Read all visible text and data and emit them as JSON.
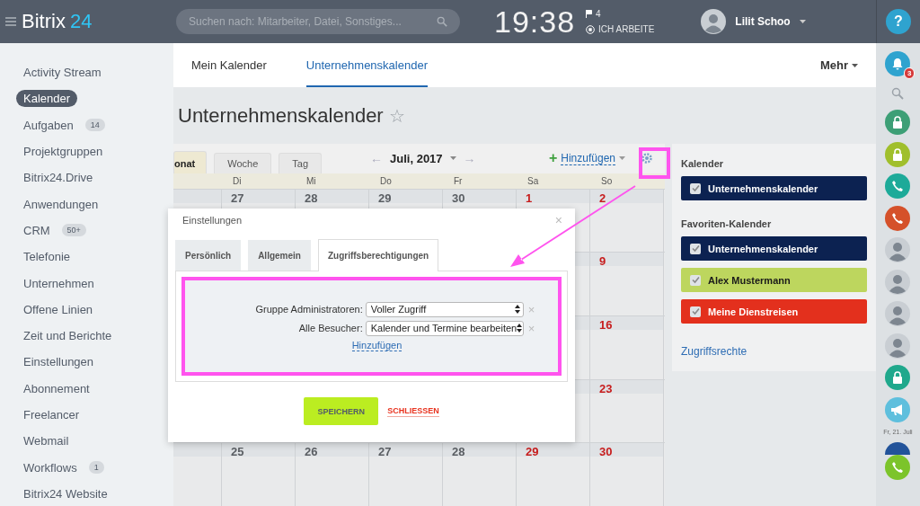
{
  "topbar": {
    "logo": "Bitrix",
    "logo_suffix": "24",
    "search": {
      "placeholder": "Suchen nach: Mitarbeiter, Datei, Sonstiges..."
    },
    "clock": "19:38",
    "flag_count": "4",
    "status": "ICH ARBEITE",
    "user": "Lilit Schoo"
  },
  "sidebar": {
    "items": [
      {
        "label": "Activity Stream",
        "selected": false
      },
      {
        "label": "Kalender",
        "selected": true
      },
      {
        "label": "Aufgaben",
        "badge": "14",
        "selected": false
      },
      {
        "label": "Projektgruppen",
        "selected": false
      },
      {
        "label": "Bitrix24.Drive",
        "selected": false
      },
      {
        "label": "Anwendungen",
        "selected": false
      },
      {
        "label": "CRM",
        "badge": "50+",
        "selected": false
      },
      {
        "label": "Telefonie",
        "selected": false
      },
      {
        "label": "Unternehmen",
        "selected": false
      },
      {
        "label": "Offene Linien",
        "selected": false
      },
      {
        "label": "Zeit und Berichte",
        "selected": false
      },
      {
        "label": "Einstellungen",
        "selected": false
      },
      {
        "label": "Abonnement",
        "selected": false
      },
      {
        "label": "Freelancer",
        "selected": false
      },
      {
        "label": "Webmail",
        "selected": false
      },
      {
        "label": "Workflows",
        "badge": "1",
        "selected": false
      },
      {
        "label": "Bitrix24 Website",
        "selected": false
      }
    ]
  },
  "tabs": [
    {
      "label": "Mein Kalender",
      "selected": false
    },
    {
      "label": "Unternehmenskalender",
      "selected": true
    }
  ],
  "more": "Mehr",
  "page_title": "Unternehmenskalender",
  "star": "☆",
  "calendar": {
    "views": [
      {
        "label": "onat",
        "selected": true
      },
      {
        "label": "Woche",
        "selected": false
      },
      {
        "label": "Tag",
        "selected": false
      }
    ],
    "prev": "←",
    "month": "Juli, 2017",
    "next": "→",
    "add_plus": "+",
    "add": "Hinzufügen",
    "weekdays": [
      "Di",
      "Mi",
      "Do",
      "Fr",
      "Sa",
      "So"
    ],
    "weeks": [
      {
        "days": [
          {
            "date": "27",
            "weekend": false
          },
          {
            "date": "28",
            "weekend": false
          },
          {
            "date": "29",
            "weekend": false
          },
          {
            "date": "30",
            "weekend": false
          },
          {
            "date": "1",
            "weekend": true
          },
          {
            "date": "2",
            "weekend": true
          }
        ]
      },
      {
        "days": [
          {
            "date": "9",
            "weekend": true
          }
        ]
      },
      {
        "days": [
          {
            "date": "16",
            "weekend": true
          }
        ]
      },
      {
        "days": [
          {
            "date": "23",
            "weekend": true
          }
        ]
      },
      {
        "days": [
          {
            "date": "25",
            "weekend": false
          },
          {
            "date": "26",
            "weekend": false
          },
          {
            "date": "27",
            "weekend": false
          },
          {
            "date": "28",
            "weekend": false
          },
          {
            "date": "29",
            "weekend": true
          },
          {
            "date": "30",
            "weekend": true
          }
        ]
      }
    ]
  },
  "panel": {
    "sections": [
      {
        "title": "Kalender",
        "items": [
          {
            "label": "Unternehmenskalender",
            "color": "#0c2251",
            "checked": true
          }
        ]
      },
      {
        "title": "Favoriten-Kalender",
        "items": [
          {
            "label": "Unternehmenskalender",
            "color": "#0c2251",
            "checked": true
          },
          {
            "label": "Alex Mustermann",
            "color": "#bdd65e",
            "checked": true
          },
          {
            "label": "Meine Dienstreisen",
            "color": "#e3301d",
            "checked": true
          }
        ]
      }
    ],
    "link": "Zugriffsrechte"
  },
  "dialog": {
    "title": "Einstellungen",
    "close": "×",
    "tabs": [
      {
        "label": "Persönlich",
        "selected": false
      },
      {
        "label": "Allgemein",
        "selected": false
      },
      {
        "label": "Zugriffsberechtigungen",
        "selected": true
      }
    ],
    "rows": [
      {
        "label": "Gruppe Administratoren:",
        "value": "Voller Zugriff",
        "remove": "×"
      },
      {
        "label": "Alle Besucher:",
        "value": "Kalender und Termine bearbeiten",
        "remove": "×"
      }
    ],
    "add": "Hinzufügen",
    "save": "SPEICHERN",
    "cancel": "SCHLIESSEN"
  },
  "strip": [
    {
      "kind": "help",
      "label": "?",
      "color": "#2fa3cf"
    },
    {
      "kind": "bell",
      "badge": "3",
      "color": "#2fa3cf"
    },
    {
      "kind": "search"
    },
    {
      "kind": "lock",
      "color": "#3d9f76"
    },
    {
      "kind": "lock",
      "color": "#a0bf2c"
    },
    {
      "kind": "phone",
      "color": "#1daa99"
    },
    {
      "kind": "phone",
      "color": "#d5512a"
    },
    {
      "kind": "avatar"
    },
    {
      "kind": "avatar"
    },
    {
      "kind": "avatar"
    },
    {
      "kind": "avatar"
    },
    {
      "kind": "lock",
      "color": "#1fa88c"
    },
    {
      "kind": "megaphone",
      "color": "#5ebfdd"
    },
    {
      "kind": "date",
      "label": "Fr, 21. Juli"
    },
    {
      "kind": "logo",
      "color": "#22539a"
    },
    {
      "kind": "phone",
      "color": "#7cc42b"
    }
  ]
}
